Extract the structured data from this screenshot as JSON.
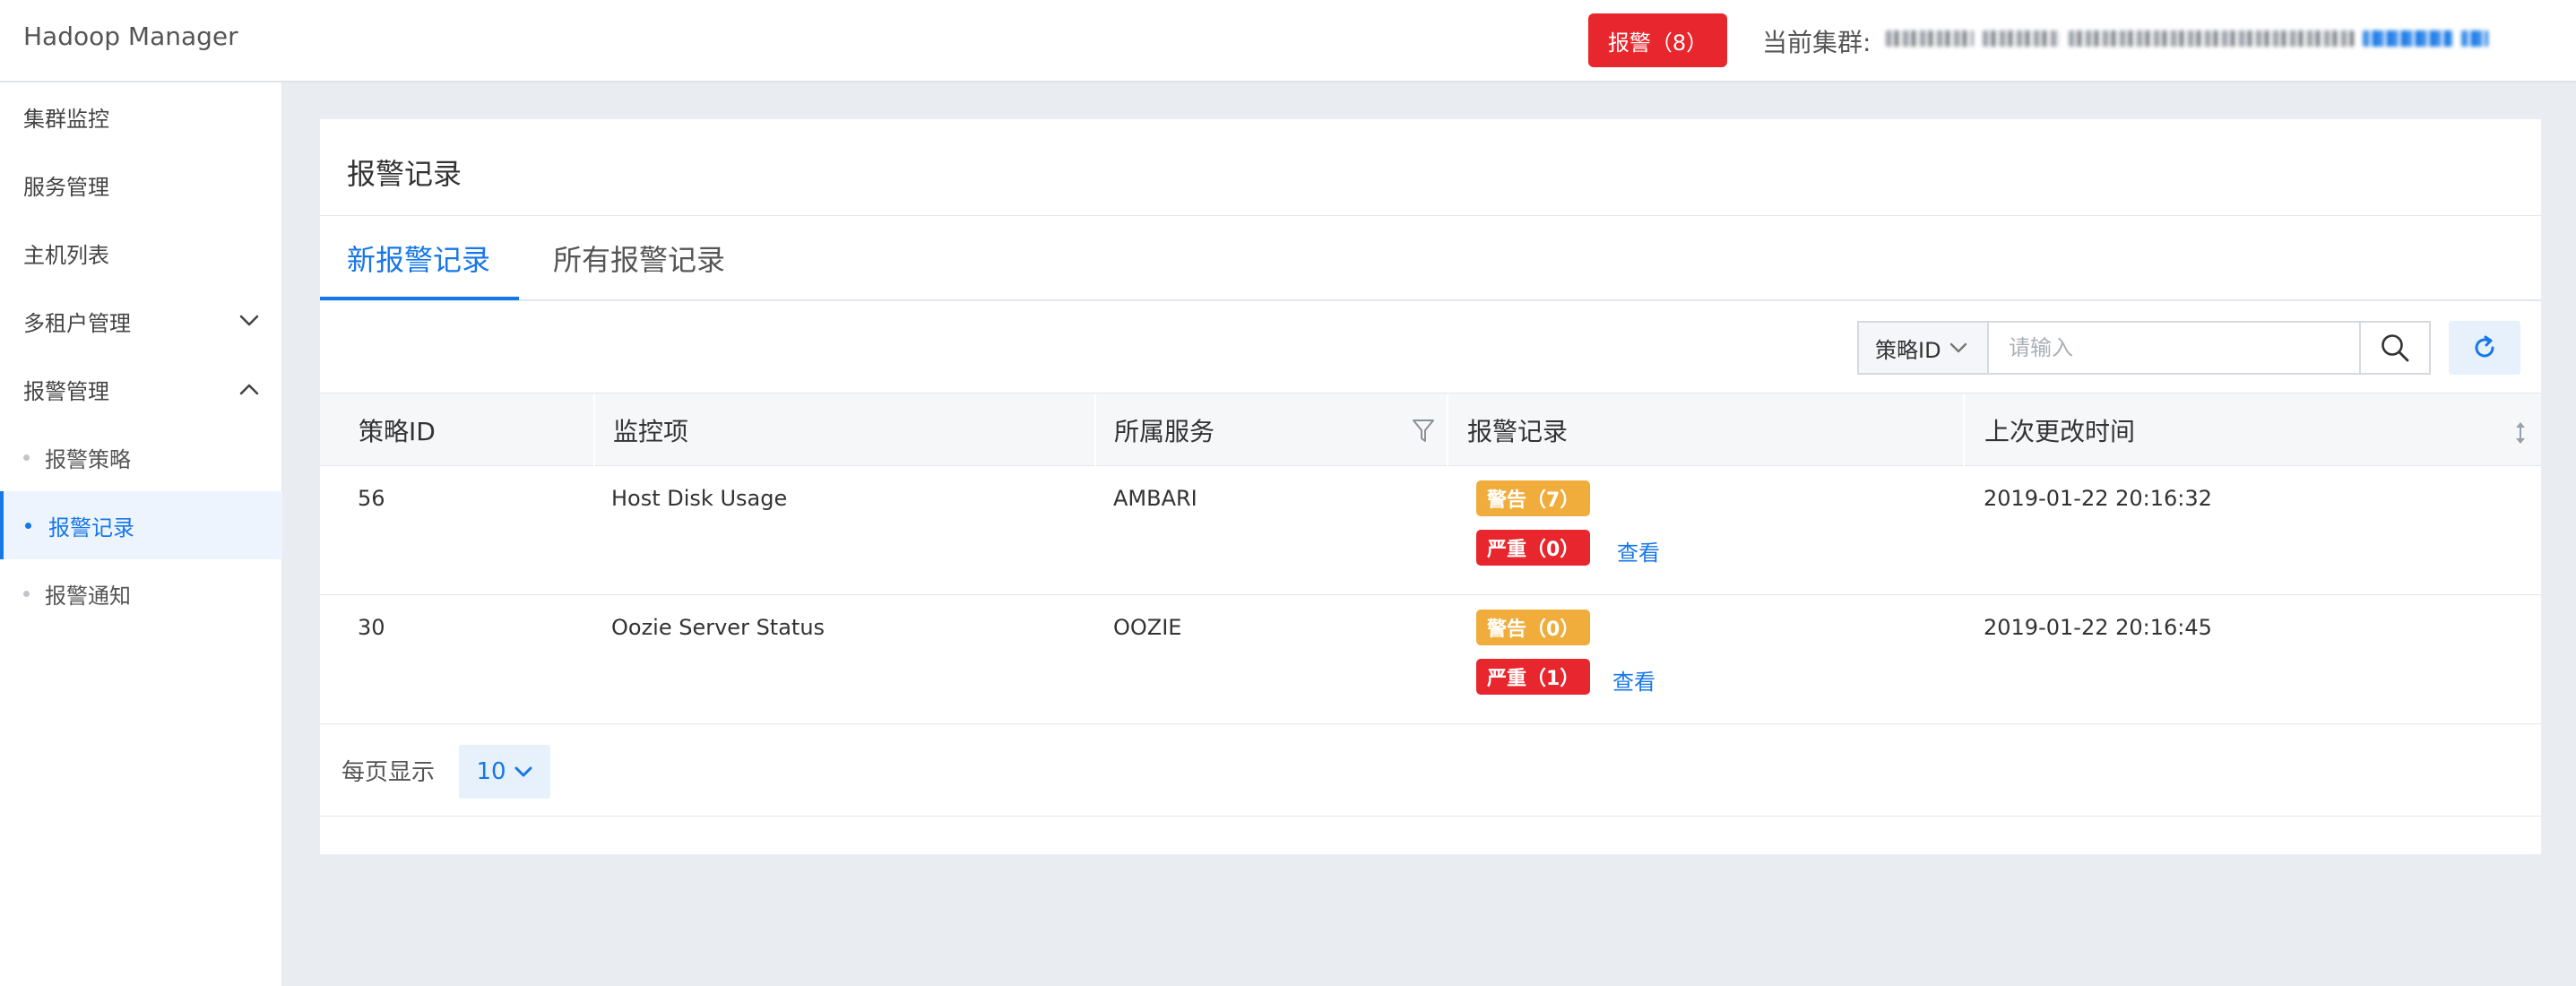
{
  "app": {
    "title": "Hadoop Manager"
  },
  "header": {
    "alarm_button": "报警（8）",
    "cluster_label": "当前集群:"
  },
  "sidebar": {
    "items": [
      {
        "label": "集群监控"
      },
      {
        "label": "服务管理"
      },
      {
        "label": "主机列表"
      },
      {
        "label": "多租户管理",
        "chevron": "chevron-down-icon"
      },
      {
        "label": "报警管理",
        "chevron": "chevron-up-icon"
      }
    ],
    "sub_items": [
      {
        "label": "报警策略"
      },
      {
        "label": "报警记录",
        "active": true
      },
      {
        "label": "报警通知"
      }
    ]
  },
  "main": {
    "title": "报警记录",
    "tabs": [
      {
        "label": "新报警记录",
        "active": true
      },
      {
        "label": "所有报警记录"
      }
    ],
    "search": {
      "field_select": "策略ID",
      "placeholder": "请输入",
      "search_icon": "search-icon",
      "refresh_icon": "refresh-icon"
    },
    "table": {
      "headers": [
        "策略ID",
        "监控项",
        "所属服务",
        "报警记录",
        "上次更改时间"
      ],
      "rows": [
        {
          "id": "56",
          "item": "Host Disk Usage",
          "service": "AMBARI",
          "warn": "警告（7）",
          "crit": "严重（0）",
          "view": "查看",
          "time": "2019-01-22 20:16:32"
        },
        {
          "id": "30",
          "item": "Oozie Server Status",
          "service": "OOZIE",
          "warn": "警告（0）",
          "crit": "严重（1）",
          "view": "查看",
          "time": "2019-01-22 20:16:45"
        }
      ]
    },
    "pagination": {
      "label": "每页显示",
      "page_size": "10"
    }
  },
  "colors": {
    "accent": "#1677e8",
    "alarm": "#e8262d",
    "warning": "#f0ad3b",
    "background": "#e9ecf1"
  }
}
